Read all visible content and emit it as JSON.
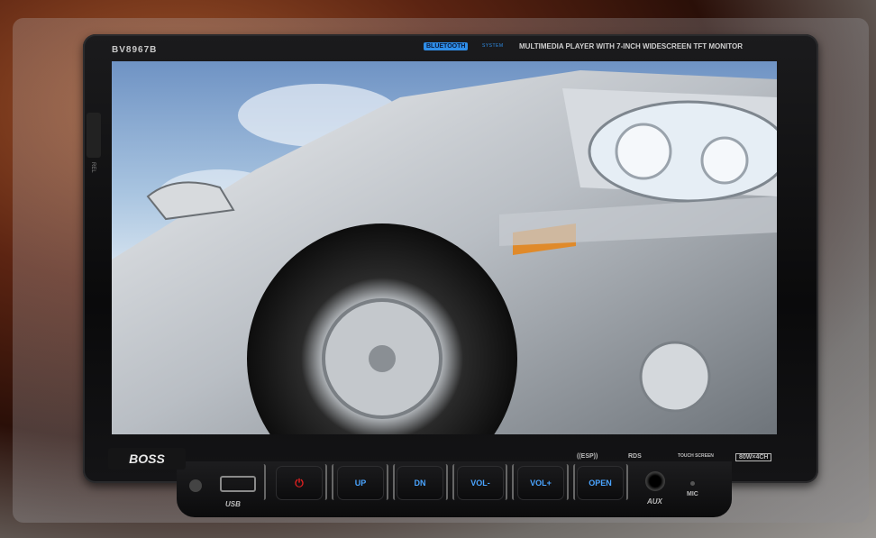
{
  "header": {
    "model": "BV8967B",
    "bluetooth_badge": "BLUETOOTH",
    "bluetooth_sub": "SYSTEM",
    "tagline": "MULTIMEDIA PLAYER WITH 7-INCH WIDESCREEN TFT MONITOR"
  },
  "side": {
    "rel_label": "REL"
  },
  "brand": {
    "logo": "BOSS"
  },
  "badges": {
    "esp": "((ESP))",
    "rds": "RDS",
    "touch": "TOUCH SCREEN",
    "power": "80W×4CH"
  },
  "controls": {
    "usb_label": "USB",
    "power_symbol": "⏻",
    "up": "UP",
    "dn": "DN",
    "vol_minus": "VOL-",
    "vol_plus": "VOL+",
    "open": "OPEN",
    "aux_label": "AUX",
    "mic_label": "MIC"
  },
  "colors": {
    "button_text": "#4aa4ff",
    "power": "#e02020",
    "bluetooth": "#2f8ee8"
  }
}
